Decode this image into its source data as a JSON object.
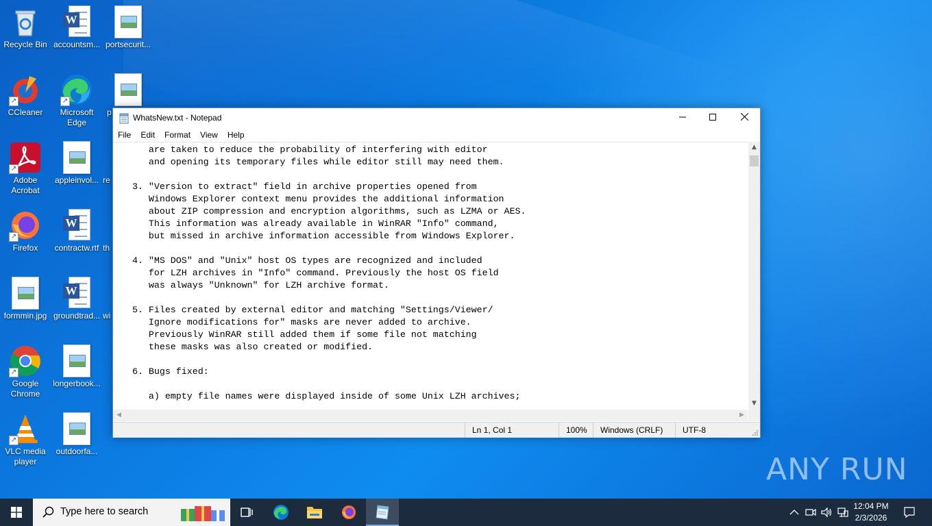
{
  "desktop": {
    "icons": [
      {
        "label": "Recycle Bin",
        "icon": "recycle-bin-icon"
      },
      {
        "label": "accountsm...",
        "icon": "word-doc-icon"
      },
      {
        "label": "portsecurit...",
        "icon": "image-file-icon"
      },
      {
        "label": "CCleaner",
        "icon": "ccleaner-icon"
      },
      {
        "label": "Microsoft Edge",
        "icon": "edge-icon"
      },
      {
        "label": "p",
        "icon": "image-file-icon"
      },
      {
        "label": "Adobe Acrobat",
        "icon": "acrobat-icon"
      },
      {
        "label": "appleinvol...",
        "icon": "image-file-icon"
      },
      {
        "label": "re",
        "icon": "file-icon"
      },
      {
        "label": "Firefox",
        "icon": "firefox-icon"
      },
      {
        "label": "contractw.rtf",
        "icon": "word-doc-icon"
      },
      {
        "label": "th",
        "icon": "file-icon"
      },
      {
        "label": "formmin.jpg",
        "icon": "image-file-icon"
      },
      {
        "label": "groundtrad...",
        "icon": "word-doc-icon"
      },
      {
        "label": "wi",
        "icon": "file-icon"
      },
      {
        "label": "Google Chrome",
        "icon": "chrome-icon"
      },
      {
        "label": "longerbook...",
        "icon": "image-file-icon"
      },
      {
        "label": "VLC media player",
        "icon": "vlc-icon"
      },
      {
        "label": "outdoorfa...",
        "icon": "image-file-icon"
      }
    ],
    "watermark": "ANY RUN"
  },
  "notepad": {
    "title": "WhatsNew.txt - Notepad",
    "menu": [
      "File",
      "Edit",
      "Format",
      "View",
      "Help"
    ],
    "text": "      are taken to reduce the probability of interfering with editor\n      and opening its temporary files while editor still may need them.\n\n   3. \"Version to extract\" field in archive properties opened from\n      Windows Explorer context menu provides the additional information\n      about ZIP compression and encryption algorithms, such as LZMA or AES.\n      This information was already available in WinRAR \"Info\" command,\n      but missed in archive information accessible from Windows Explorer.\n\n   4. \"MS DOS\" and \"Unix\" host OS types are recognized and included\n      for LZH archives in \"Info\" command. Previously the host OS field\n      was always \"Unknown\" for LZH archive format.\n\n   5. Files created by external editor and matching \"Settings/Viewer/\n      Ignore modifications for\" masks are never added to archive.\n      Previously WinRAR still added them if some file not matching\n      these masks was also created or modified.\n\n   6. Bugs fixed:\n\n      a) empty file names were displayed inside of some Unix LZH archives;",
    "status": {
      "position": "Ln 1, Col 1",
      "zoom": "100%",
      "line_ending": "Windows (CRLF)",
      "encoding": "UTF-8"
    }
  },
  "taskbar": {
    "search_placeholder": "Type here to search",
    "time": "12:04 PM",
    "date": "2/3/2026"
  }
}
